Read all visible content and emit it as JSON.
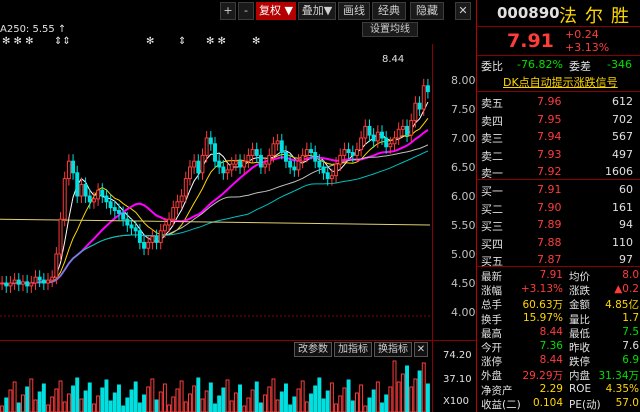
{
  "toolbar": {
    "buttons": [
      {
        "id": "plus",
        "label": "+"
      },
      {
        "id": "minus",
        "label": "-"
      },
      {
        "id": "fq",
        "label": "复权 ▼"
      },
      {
        "id": "overlay",
        "label": "叠加▼"
      },
      {
        "id": "draw",
        "label": "画线"
      },
      {
        "id": "classic",
        "label": "经典"
      },
      {
        "id": "hide",
        "label": "隐藏"
      }
    ],
    "close_label": "✕"
  },
  "chart": {
    "ma_label": "A250: 5.55 ↑",
    "settings_button": "设置均线",
    "high_price_label": "8.44",
    "y_ticks": [
      "8.00",
      "7.50",
      "7.00",
      "6.50",
      "6.00",
      "5.50",
      "5.00",
      "4.50",
      "4.00"
    ],
    "ann_stars": [
      "✻ ✻ ✻",
      "⇕⇕",
      "✻",
      "⇕",
      "✻ ✻",
      "✻"
    ],
    "sub_buttons": [
      "改参数",
      "加指标",
      "换指标"
    ],
    "sub_close": "✕",
    "vol_ticks": [
      "74.20",
      "37.10",
      "X100"
    ]
  },
  "stock": {
    "code": "000890",
    "name": "法尔胜",
    "price": "7.91",
    "change": "+0.24",
    "change_pct": "+3.13%",
    "wb_label": "委比",
    "wb_value": "-76.82%",
    "wc_label": "委差",
    "wc_value": "-346",
    "signal_link": "DK点自动提示涨跌信号"
  },
  "orderbook": {
    "asks": [
      {
        "label": "卖五",
        "price": "7.96",
        "vol": "612"
      },
      {
        "label": "卖四",
        "price": "7.95",
        "vol": "702"
      },
      {
        "label": "卖三",
        "price": "7.94",
        "vol": "567"
      },
      {
        "label": "卖二",
        "price": "7.93",
        "vol": "497"
      },
      {
        "label": "卖一",
        "price": "7.92",
        "vol": "1606"
      }
    ],
    "bids": [
      {
        "label": "买一",
        "price": "7.91",
        "vol": "60"
      },
      {
        "label": "买二",
        "price": "7.90",
        "vol": "161"
      },
      {
        "label": "买三",
        "price": "7.89",
        "vol": "94"
      },
      {
        "label": "买四",
        "price": "7.88",
        "vol": "110"
      },
      {
        "label": "买五",
        "price": "7.87",
        "vol": "97"
      }
    ]
  },
  "stats": [
    {
      "l1": "最新",
      "v1": "7.91",
      "l2": "均价",
      "v2": "8.0"
    },
    {
      "l1": "涨幅",
      "v1": "+3.13%",
      "l2": "涨跌",
      "v2": "▲0.2"
    },
    {
      "l1": "总手",
      "v1": "60.63万",
      "l2": "金额",
      "v2": "4.85亿"
    },
    {
      "l1": "换手",
      "v1": "15.97%",
      "l2": "量比",
      "v2": "1.7"
    },
    {
      "l1": "最高",
      "v1": "8.44",
      "l2": "最低",
      "v2": "7.5"
    },
    {
      "l1": "今开",
      "v1": "7.36",
      "l2": "昨收",
      "v2": "7.6"
    },
    {
      "l1": "涨停",
      "v1": "8.44",
      "l2": "跌停",
      "v2": "6.9"
    },
    {
      "l1": "外盘",
      "v1": "29.29万",
      "l2": "内盘",
      "v2": "31.34万"
    },
    {
      "l1": "净资产",
      "v1": "2.29",
      "l2": "ROE",
      "v2": "4.35%"
    },
    {
      "l1": "收益(二)",
      "v1": "0.104",
      "l2": "PE(动)",
      "v2": "57.0"
    }
  ],
  "colors": {
    "up": "#ff3c3c",
    "down": "#00e0e0",
    "ma5": "#ffffff",
    "ma10": "#ffd700",
    "ma20": "#ff00ff",
    "ma60": "#c0c0c0",
    "ma120": "#00c0c0",
    "ma250": "#e0d070"
  }
}
